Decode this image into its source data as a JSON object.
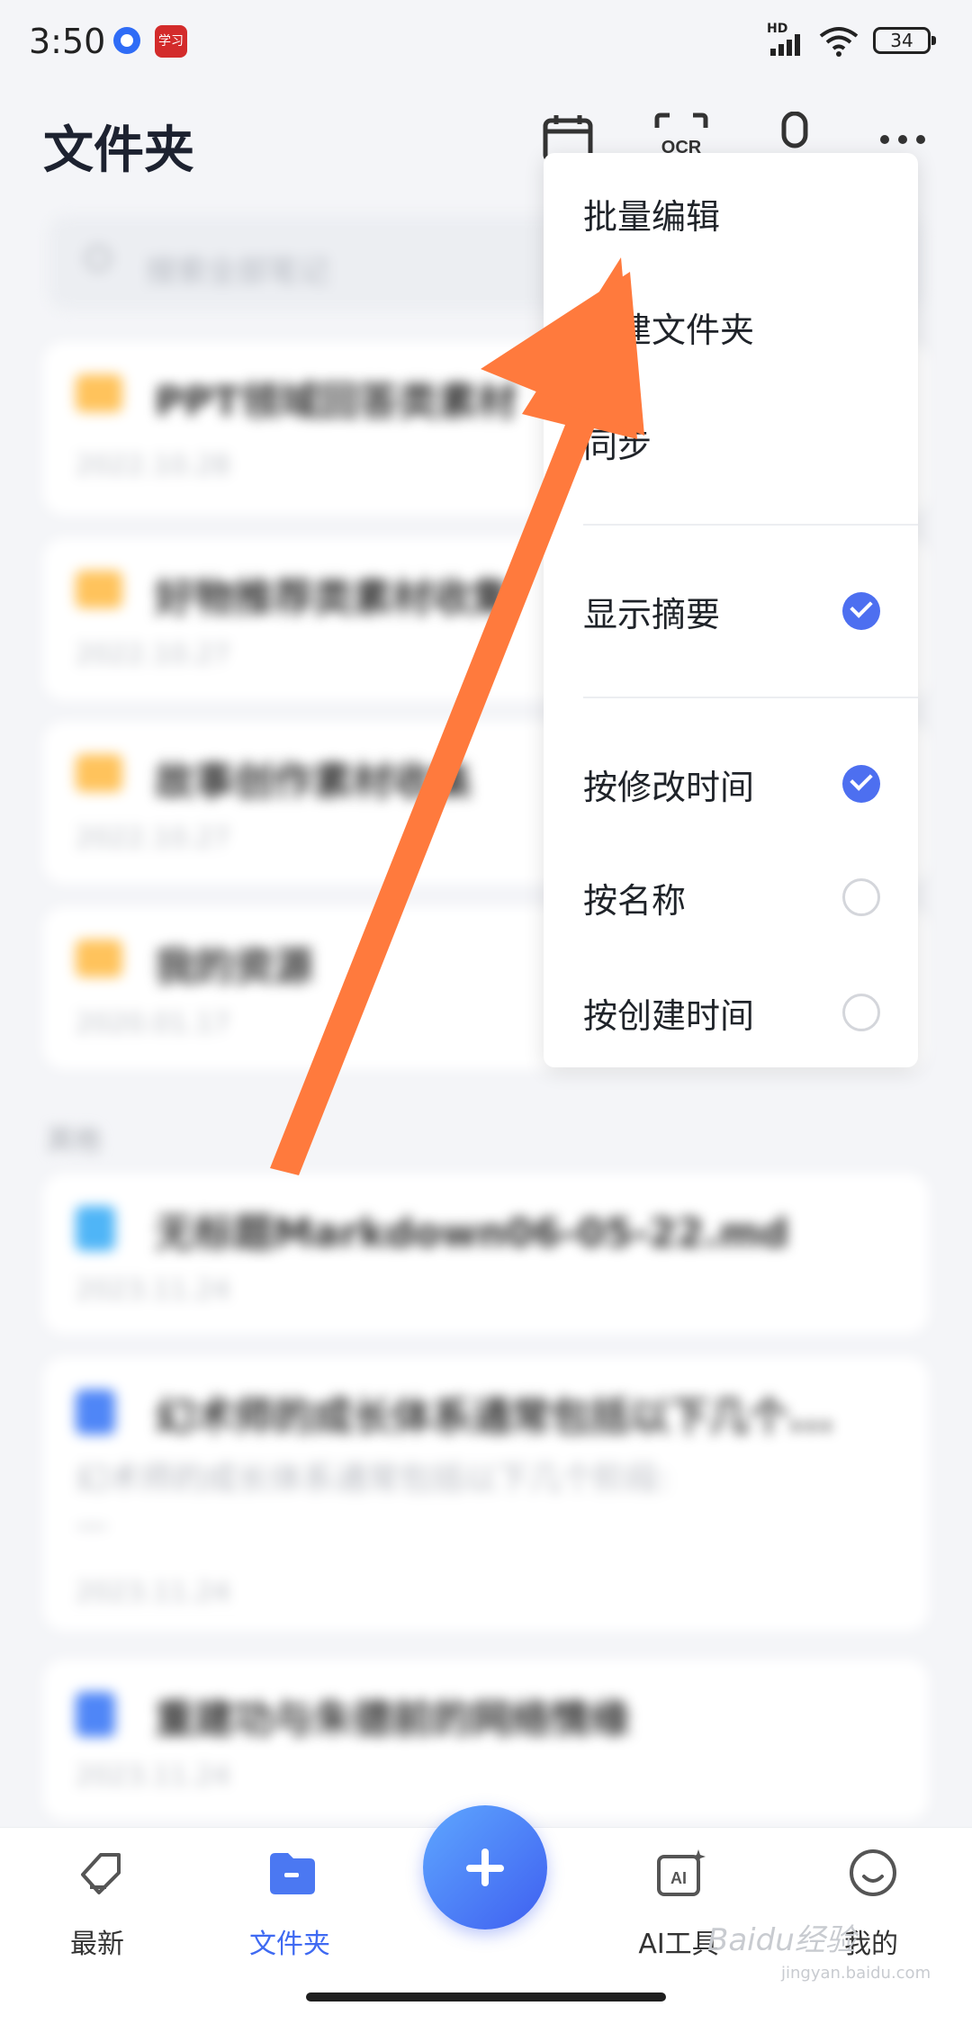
{
  "status_bar": {
    "time": "3:50",
    "network": "HD",
    "battery": "34",
    "app2_label": "学习"
  },
  "header": {
    "title": "文件夹",
    "icons": [
      "calendar-check-icon",
      "ocr-icon",
      "microphone-icon",
      "more-icon"
    ],
    "ocr_label": "OCR"
  },
  "search": {
    "placeholder": "搜索全部笔记"
  },
  "folders": [
    {
      "title": "PPT领域回答类素材",
      "date": "2022.10.28"
    },
    {
      "title": "好物推荐类素材收集",
      "date": "2022.10.27"
    },
    {
      "title": "故事创作素材收集",
      "date": "2022.10.27"
    },
    {
      "title": "我的资源",
      "date": "2020.01.17"
    }
  ],
  "section_label": "其他",
  "notes": [
    {
      "title": "无标题Markdown06-05-22.md",
      "date": "2023.11.24",
      "desc": ""
    },
    {
      "title": "幻术师的成长体系通常包括以下几个...",
      "date": "2023.11.24",
      "desc": "幻术师的成长体系通常包括以下几个阶段:",
      "desc2": "—"
    },
    {
      "title": "重建功与朱德前的网络情缘",
      "date": "2023.11.24",
      "desc": ""
    }
  ],
  "menu": {
    "items": [
      {
        "label": "批量编辑"
      },
      {
        "label": "新建文件夹"
      },
      {
        "label": "同步"
      },
      {
        "label": "显示摘要",
        "checked": true
      },
      {
        "label": "按修改时间",
        "checked": true
      },
      {
        "label": "按名称",
        "checked": false
      },
      {
        "label": "按创建时间",
        "checked": false
      }
    ]
  },
  "bottom_nav": [
    {
      "label": "最新",
      "icon": "tag-icon"
    },
    {
      "label": "文件夹",
      "icon": "folder-icon",
      "active": true
    },
    {
      "label": "AI工具",
      "icon": "ai-icon"
    },
    {
      "label": "我的",
      "icon": "smiley-icon"
    }
  ],
  "watermark": {
    "text": "Baidu经验",
    "sub": "jingyan.baidu.com"
  },
  "colors": {
    "accent": "#4d6ff0",
    "arrow": "#ff7a3d",
    "folder": "#ffc35c",
    "doc": "#4f86f7"
  }
}
